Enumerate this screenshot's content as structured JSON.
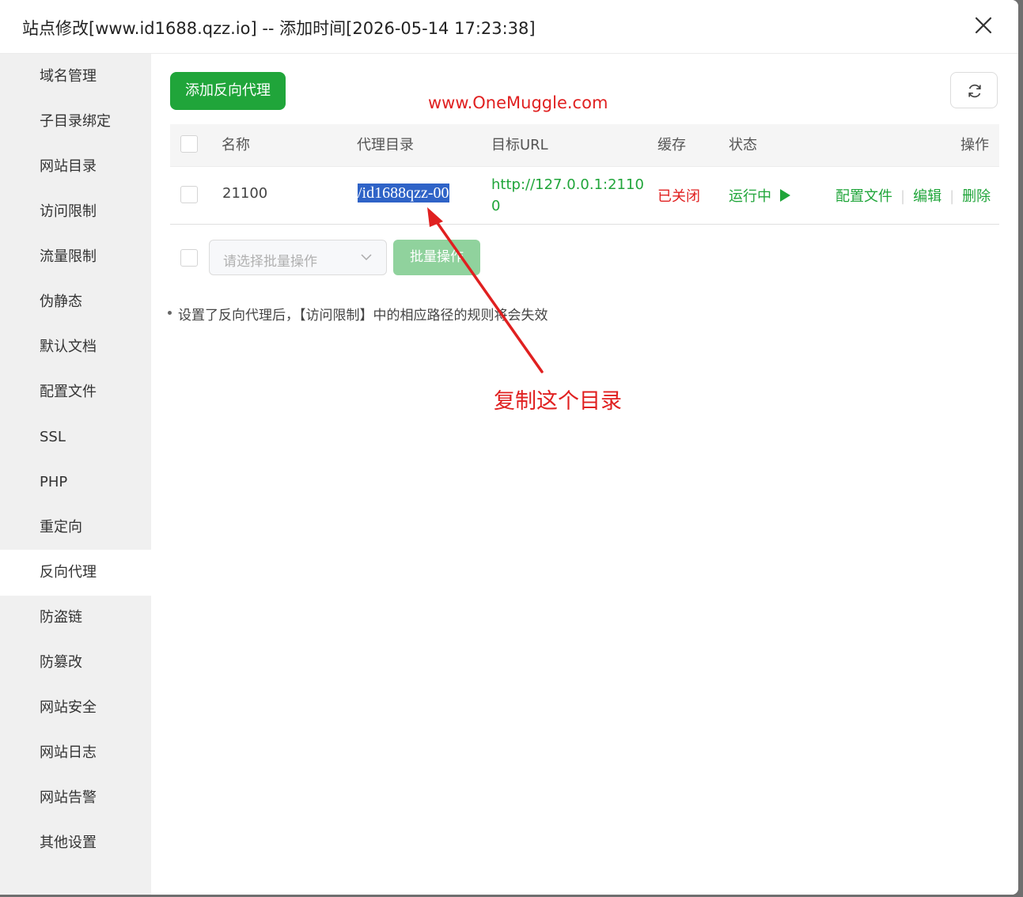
{
  "dialog": {
    "title": "站点修改[www.id1688.qzz.io] -- 添加时间[2026-05-14 17:23:38]"
  },
  "sidebar": {
    "items": [
      {
        "label": "域名管理"
      },
      {
        "label": "子目录绑定"
      },
      {
        "label": "网站目录"
      },
      {
        "label": "访问限制"
      },
      {
        "label": "流量限制"
      },
      {
        "label": "伪静态"
      },
      {
        "label": "默认文档"
      },
      {
        "label": "配置文件"
      },
      {
        "label": "SSL"
      },
      {
        "label": "PHP"
      },
      {
        "label": "重定向"
      },
      {
        "label": "反向代理"
      },
      {
        "label": "防盗链"
      },
      {
        "label": "防篡改"
      },
      {
        "label": "网站安全"
      },
      {
        "label": "网站日志"
      },
      {
        "label": "网站告警"
      },
      {
        "label": "其他设置"
      }
    ],
    "active": "反向代理"
  },
  "toolbar": {
    "add_label": "添加反向代理",
    "refresh_icon": "refresh-icon"
  },
  "watermark": "www.OneMuggle.com",
  "table": {
    "headers": {
      "name": "名称",
      "dir": "代理目录",
      "url": "目标URL",
      "cache": "缓存",
      "status": "状态",
      "actions": "操作"
    },
    "rows": [
      {
        "name": "21100",
        "dir": "/id1688qzz-00",
        "url_line1": "http://127.0.0.1:2110",
        "url_line2": "0",
        "cache": "已关闭",
        "status": "运行中",
        "status_icon": "play-icon",
        "action_config": "配置文件",
        "action_edit": "编辑",
        "action_delete": "删除"
      }
    ]
  },
  "batch": {
    "placeholder": "请选择批量操作",
    "button": "批量操作"
  },
  "tip": "设置了反向代理后，【访问限制】中的相应路径的规则将会失效",
  "annotation": "复制这个目录",
  "colors": {
    "accent": "#20a53a",
    "danger": "#e02020",
    "selection": "#2f63c7"
  }
}
